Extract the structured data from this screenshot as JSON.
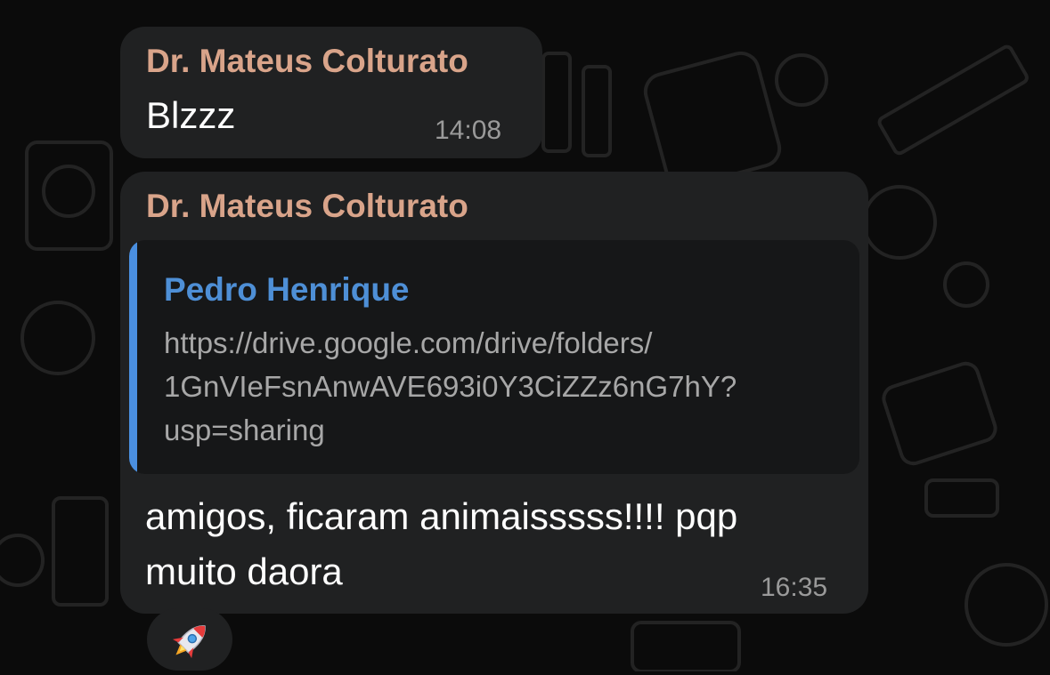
{
  "messages": [
    {
      "sender": "Dr. Mateus Colturato",
      "text": "Blzzz",
      "time": "14:08"
    },
    {
      "sender": "Dr. Mateus Colturato",
      "quote": {
        "author": "Pedro Henrique",
        "lines": [
          "https://drive.google.com/drive/folders/",
          "1GnVIeFsnAnwAVE693i0Y3CiZZz6nG7hY?",
          "usp=sharing"
        ]
      },
      "text_lines": [
        "amigos, ficaram animaisssss!!!! pqp",
        "muito daora"
      ],
      "time": "16:35",
      "reaction": "rocket-emoji"
    }
  ],
  "colors": {
    "background": "#0b0b0b",
    "bubble": "#202122",
    "sender_name": "#d9a48a",
    "quote_accent": "#4a8fe0",
    "quote_author": "#4e8fd6"
  }
}
